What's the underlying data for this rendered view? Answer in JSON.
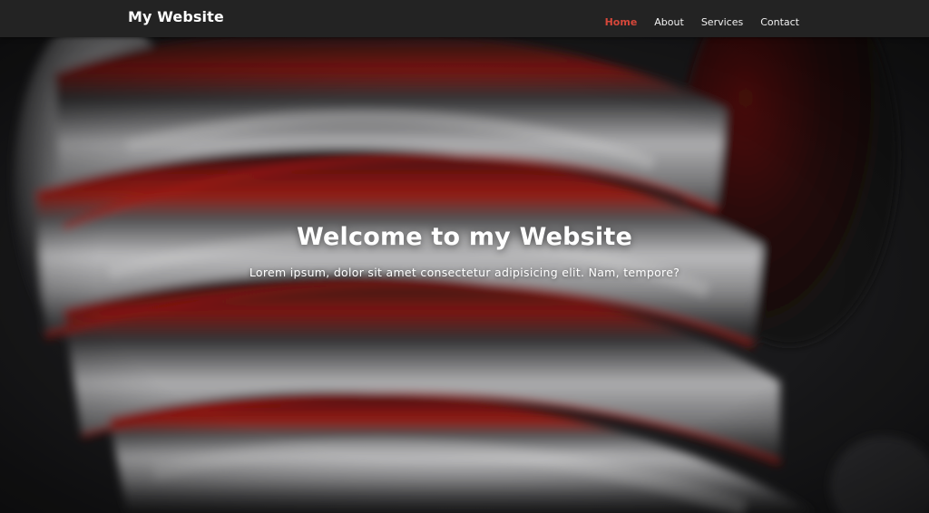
{
  "navbar": {
    "brand": "My Website",
    "links": [
      {
        "label": "Home",
        "active": true
      },
      {
        "label": "About",
        "active": false
      },
      {
        "label": "Services",
        "active": false
      },
      {
        "label": "Contact",
        "active": false
      }
    ]
  },
  "hero": {
    "title": "Welcome to my Website",
    "subtitle": "Lorem ipsum, dolor sit amet consectetur adipisicing elit. Nam, tempore?",
    "background_image": "abstract red and white swirl",
    "colors": {
      "accent": "#d6473a",
      "background": "#1d1d1f",
      "swirl_light": "#c9c9cb",
      "swirl_red": "#9a1410"
    }
  }
}
